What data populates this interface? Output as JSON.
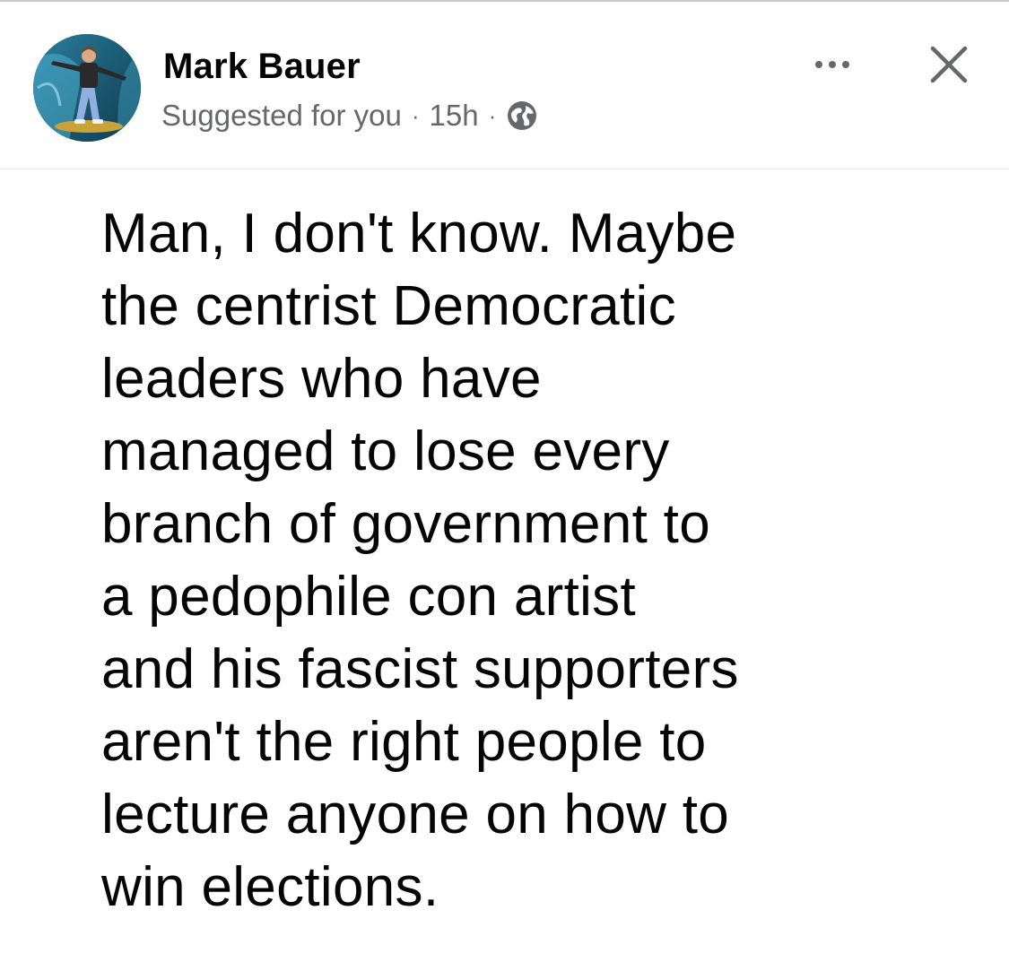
{
  "post": {
    "author": {
      "name": "Mark Bauer",
      "avatar_icon": "profile-photo-surfer"
    },
    "meta": {
      "context": "Suggested for you",
      "separator": "·",
      "time": "15h",
      "audience_icon": "globe-icon"
    },
    "actions": {
      "more_icon": "ellipsis-icon",
      "close_icon": "close-icon"
    },
    "body_text": "Man, I don't know. Maybe\nthe centrist Democratic\nleaders who have\nmanaged to lose every\nbranch of government to\na pedophile con artist\nand his fascist supporters\naren't the right people to\nlecture anyone on how to\nwin elections."
  },
  "colors": {
    "primary_text": "#050505",
    "secondary_text": "#65676b",
    "divider": "#e4e6eb",
    "background": "#ffffff"
  }
}
